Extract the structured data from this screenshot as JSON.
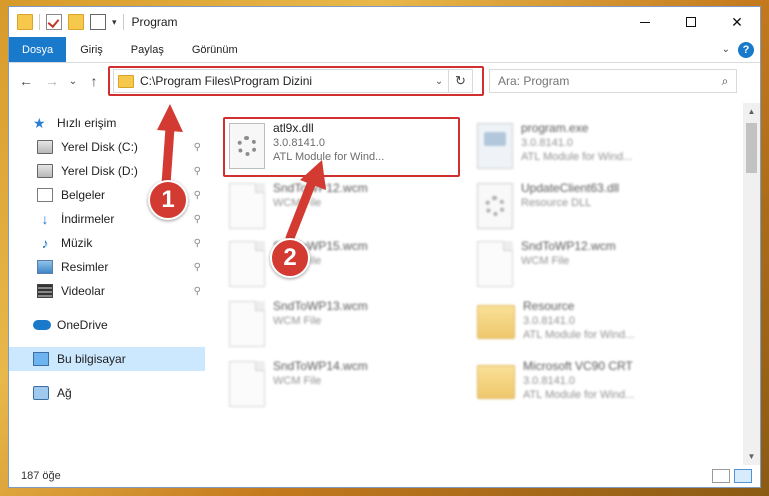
{
  "window": {
    "title": "Program",
    "minimize": "—",
    "maximize": "☐",
    "close": "✕"
  },
  "ribbon": {
    "tabs": [
      {
        "label": "Dosya"
      },
      {
        "label": "Giriş"
      },
      {
        "label": "Paylaş"
      },
      {
        "label": "Görünüm"
      }
    ],
    "help": "?"
  },
  "address": {
    "path": "C:\\Program Files\\Program Dizini",
    "refresh": "↻",
    "dropdown": "⌄"
  },
  "search": {
    "placeholder": "Ara: Program",
    "icon": "⌕"
  },
  "nav": {
    "back": "←",
    "forward": "→",
    "up": "↑",
    "recent": "⌄",
    "quick_access": "Hızlı erişim",
    "items": [
      {
        "label": "Yerel Disk (C:)",
        "icon": "disk-icon",
        "pinned": true
      },
      {
        "label": "Yerel Disk (D:)",
        "icon": "disk-icon",
        "pinned": true
      },
      {
        "label": "Belgeler",
        "icon": "documents-icon",
        "pinned": true
      },
      {
        "label": "İndirmeler",
        "icon": "download-icon",
        "pinned": true
      },
      {
        "label": "Müzik",
        "icon": "music-icon",
        "pinned": true
      },
      {
        "label": "Resimler",
        "icon": "pictures-icon",
        "pinned": true
      },
      {
        "label": "Videolar",
        "icon": "videos-icon",
        "pinned": true
      }
    ],
    "onedrive": "OneDrive",
    "this_pc": "Bu bilgisayar",
    "network": "Ağ",
    "pin_glyph": "📌"
  },
  "files": [
    {
      "name": "atl9x.dll",
      "line2": "3.0.8141.0",
      "line3": "ATL Module for Wind...",
      "icon": "dll-gear-icon",
      "highlighted": true
    },
    {
      "name": "program.exe",
      "line2": "3.0.8141.0",
      "line3": "ATL Module for Wind...",
      "icon": "exe-icon"
    },
    {
      "name": "SndToWP12.wcm",
      "line2": "WCM File",
      "line3": "",
      "icon": "file-icon"
    },
    {
      "name": "UpdateClient63.dll",
      "line2": "Resource DLL",
      "line3": "",
      "icon": "dll-gear-icon"
    },
    {
      "name": "SndToWP15.wcm",
      "line2": "WCM File",
      "line3": "",
      "icon": "file-icon"
    },
    {
      "name": "SndToWP12.wcm",
      "line2": "WCM File",
      "line3": "",
      "icon": "file-icon"
    },
    {
      "name": "SndToWP13.wcm",
      "line2": "WCM File",
      "line3": "",
      "icon": "file-icon"
    },
    {
      "name": "Resource",
      "line2": "3.0.8141.0",
      "line3": "ATL Module for Wind...",
      "icon": "folder-icon"
    },
    {
      "name": "SndToWP14.wcm",
      "line2": "WCM File",
      "line3": "",
      "icon": "file-icon"
    },
    {
      "name": "Microsoft VC90 CRT",
      "line2": "3.0.8141.0",
      "line3": "ATL Module for Wind...",
      "icon": "folder-icon"
    }
  ],
  "status": {
    "count": "187 öğe"
  },
  "annotations": {
    "step1": "1",
    "step2": "2",
    "color": "#d23a32"
  },
  "colors": {
    "accent": "#1979ca",
    "selection": "#cce8ff",
    "highlight_box": "#d0302f"
  }
}
